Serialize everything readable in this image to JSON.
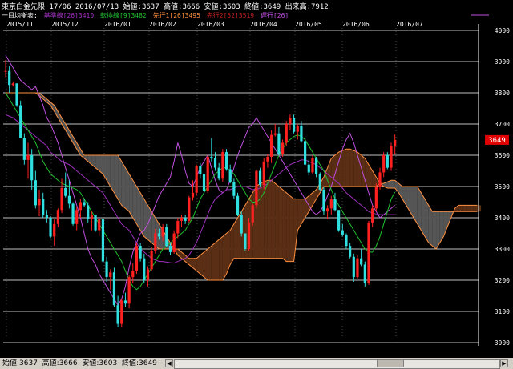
{
  "header": {
    "line1": "東京白金先限 17/06 2016/07/13 始値:3637 高値:3666 安値:3603 終値:3649 出来高:7912",
    "legend_prefix": "一目均衡表:",
    "legend": [
      {
        "label": "基準線[26]3410",
        "color": "#a030c0"
      },
      {
        "label": "転換線[9]3482",
        "color": "#20c030"
      },
      {
        "label": "先行1[26]3495",
        "color": "#ff9040"
      },
      {
        "label": "先行2[52]3519",
        "color": "#c02020"
      },
      {
        "label": "遅行[26]",
        "color": "#c050e0"
      }
    ]
  },
  "price_box": {
    "value": "3649",
    "color": "#e00000"
  },
  "status": {
    "text": "始値:3637  高値:3666  安値:3603  終値:3649"
  },
  "colors": {
    "background": "#000000",
    "grid": "#ffffff",
    "candle_up": "#ff2020",
    "candle_down": "#30e0e0",
    "kijun": "#a030c0",
    "tenkan": "#20c030",
    "senkou1": "#ff9040",
    "senkou2": "#c02020",
    "chikou": "#c050e0",
    "kumo_up": "#5a2e14",
    "kumo_down": "#555555"
  },
  "chart_data": {
    "type": "candlestick",
    "title": "東京白金先限",
    "months": [
      "2015/11",
      "2015/12",
      "2016/01",
      "2016/02",
      "2016/03",
      "2016/04",
      "2016/05",
      "2016/06",
      "2016/07"
    ],
    "ylim": [
      3000,
      4000
    ],
    "yticks": [
      "4000",
      "3900",
      "3800",
      "3700",
      "3600",
      "3500",
      "3400",
      "3300",
      "3200",
      "3100",
      "3000"
    ],
    "last_close": 3649,
    "candles": [
      [
        3870,
        3905,
        3850,
        3870
      ],
      [
        3870,
        3885,
        3800,
        3825
      ],
      [
        3825,
        3835,
        3820,
        3830
      ],
      [
        3830,
        3830,
        3755,
        3760
      ],
      [
        3760,
        3775,
        3655,
        3655
      ],
      [
        3655,
        3670,
        3570,
        3585
      ],
      [
        3585,
        3640,
        3525,
        3600
      ],
      [
        3600,
        3620,
        3490,
        3520
      ],
      [
        3520,
        3550,
        3430,
        3440
      ],
      [
        3440,
        3490,
        3405,
        3460
      ],
      [
        3460,
        3480,
        3400,
        3410
      ],
      [
        3410,
        3425,
        3385,
        3400
      ],
      [
        3400,
        3405,
        3335,
        3340
      ],
      [
        3340,
        3395,
        3310,
        3380
      ],
      [
        3380,
        3430,
        3370,
        3425
      ],
      [
        3425,
        3525,
        3415,
        3495
      ],
      [
        3495,
        3545,
        3465,
        3470
      ],
      [
        3470,
        3520,
        3430,
        3445
      ],
      [
        3445,
        3450,
        3375,
        3380
      ],
      [
        3380,
        3435,
        3360,
        3425
      ],
      [
        3425,
        3460,
        3400,
        3450
      ],
      [
        3450,
        3460,
        3435,
        3440
      ],
      [
        3440,
        3450,
        3385,
        3395
      ],
      [
        3395,
        3420,
        3360,
        3410
      ],
      [
        3410,
        3410,
        3355,
        3360
      ],
      [
        3360,
        3400,
        3340,
        3395
      ],
      [
        3395,
        3395,
        3255,
        3260
      ],
      [
        3260,
        3275,
        3195,
        3210
      ],
      [
        3210,
        3235,
        3170,
        3225
      ],
      [
        3225,
        3240,
        3115,
        3120
      ],
      [
        3120,
        3150,
        3050,
        3060
      ],
      [
        3060,
        3140,
        3050,
        3135
      ],
      [
        3135,
        3160,
        3115,
        3125
      ],
      [
        3125,
        3215,
        3110,
        3210
      ],
      [
        3210,
        3255,
        3190,
        3230
      ],
      [
        3230,
        3320,
        3220,
        3310
      ],
      [
        3310,
        3320,
        3260,
        3270
      ],
      [
        3270,
        3285,
        3190,
        3200
      ],
      [
        3200,
        3245,
        3180,
        3235
      ],
      [
        3235,
        3305,
        3230,
        3295
      ],
      [
        3295,
        3365,
        3285,
        3350
      ],
      [
        3350,
        3365,
        3330,
        3340
      ],
      [
        3340,
        3380,
        3325,
        3370
      ],
      [
        3370,
        3380,
        3305,
        3310
      ],
      [
        3310,
        3320,
        3280,
        3290
      ],
      [
        3290,
        3360,
        3285,
        3350
      ],
      [
        3350,
        3400,
        3335,
        3390
      ],
      [
        3390,
        3410,
        3370,
        3400
      ],
      [
        3400,
        3410,
        3380,
        3390
      ],
      [
        3390,
        3470,
        3385,
        3465
      ],
      [
        3465,
        3520,
        3455,
        3480
      ],
      [
        3480,
        3570,
        3470,
        3565
      ],
      [
        3565,
        3575,
        3525,
        3540
      ],
      [
        3540,
        3545,
        3480,
        3485
      ],
      [
        3485,
        3600,
        3480,
        3595
      ],
      [
        3595,
        3655,
        3580,
        3590
      ],
      [
        3590,
        3610,
        3550,
        3560
      ],
      [
        3560,
        3575,
        3520,
        3525
      ],
      [
        3525,
        3620,
        3515,
        3610
      ],
      [
        3610,
        3620,
        3550,
        3555
      ],
      [
        3555,
        3570,
        3510,
        3515
      ],
      [
        3515,
        3525,
        3460,
        3470
      ],
      [
        3470,
        3480,
        3405,
        3410
      ],
      [
        3410,
        3420,
        3340,
        3350
      ],
      [
        3350,
        3350,
        3295,
        3300
      ],
      [
        3300,
        3400,
        3295,
        3385
      ],
      [
        3385,
        3445,
        3375,
        3440
      ],
      [
        3440,
        3555,
        3430,
        3550
      ],
      [
        3550,
        3560,
        3500,
        3505
      ],
      [
        3505,
        3590,
        3490,
        3580
      ],
      [
        3580,
        3605,
        3560,
        3595
      ],
      [
        3595,
        3680,
        3575,
        3665
      ],
      [
        3665,
        3700,
        3660,
        3670
      ],
      [
        3670,
        3690,
        3600,
        3605
      ],
      [
        3605,
        3650,
        3595,
        3640
      ],
      [
        3640,
        3710,
        3630,
        3700
      ],
      [
        3700,
        3730,
        3680,
        3720
      ],
      [
        3720,
        3730,
        3670,
        3675
      ],
      [
        3675,
        3700,
        3650,
        3695
      ],
      [
        3695,
        3710,
        3640,
        3645
      ],
      [
        3645,
        3660,
        3565,
        3570
      ],
      [
        3570,
        3585,
        3535,
        3545
      ],
      [
        3545,
        3600,
        3540,
        3590
      ],
      [
        3590,
        3595,
        3530,
        3540
      ],
      [
        3540,
        3545,
        3485,
        3490
      ],
      [
        3490,
        3500,
        3410,
        3420
      ],
      [
        3420,
        3440,
        3395,
        3430
      ],
      [
        3430,
        3470,
        3410,
        3460
      ],
      [
        3460,
        3480,
        3420,
        3425
      ],
      [
        3425,
        3425,
        3355,
        3360
      ],
      [
        3360,
        3380,
        3340,
        3345
      ],
      [
        3345,
        3350,
        3300,
        3310
      ],
      [
        3310,
        3320,
        3270,
        3275
      ],
      [
        3275,
        3285,
        3195,
        3210
      ],
      [
        3210,
        3280,
        3205,
        3270
      ],
      [
        3270,
        3300,
        3245,
        3250
      ],
      [
        3250,
        3260,
        3180,
        3190
      ],
      [
        3190,
        3390,
        3185,
        3385
      ],
      [
        3385,
        3440,
        3370,
        3430
      ],
      [
        3430,
        3510,
        3420,
        3500
      ],
      [
        3500,
        3560,
        3490,
        3545
      ],
      [
        3545,
        3610,
        3530,
        3600
      ],
      [
        3600,
        3610,
        3555,
        3560
      ],
      [
        3560,
        3640,
        3550,
        3630
      ],
      [
        3630,
        3666,
        3603,
        3649
      ]
    ],
    "kijun": [
      3730,
      3725,
      3720,
      3710,
      3700,
      3690,
      3680,
      3670,
      3660,
      3650,
      3640,
      3630,
      3610,
      3600,
      3590,
      3580,
      3575,
      3570,
      3560,
      3550,
      3540,
      3530,
      3520,
      3510,
      3500,
      3490,
      3480,
      3460,
      3440,
      3420,
      3400,
      3380,
      3370,
      3360,
      3340,
      3320,
      3300,
      3290,
      3280,
      3270,
      3265,
      3260,
      3260,
      3258,
      3256,
      3255,
      3260,
      3265,
      3270,
      3280,
      3300,
      3320,
      3350,
      3380,
      3410,
      3440,
      3460,
      3470,
      3480,
      3490,
      3490,
      3495,
      3500,
      3500,
      3500,
      3495,
      3490,
      3490,
      3495,
      3500,
      3510,
      3520,
      3530,
      3540,
      3550,
      3560,
      3570,
      3575,
      3580,
      3585,
      3585,
      3580,
      3575,
      3570,
      3560,
      3550,
      3540,
      3530,
      3520,
      3510,
      3495,
      3480,
      3470,
      3460,
      3450,
      3440,
      3430,
      3420,
      3415,
      3412,
      3410,
      3410,
      3410,
      3410,
      3410
    ],
    "tenkan": [
      3800,
      3780,
      3760,
      3740,
      3720,
      3700,
      3680,
      3660,
      3640,
      3610,
      3580,
      3560,
      3540,
      3530,
      3520,
      3510,
      3505,
      3500,
      3495,
      3490,
      3480,
      3460,
      3440,
      3420,
      3400,
      3380,
      3360,
      3340,
      3320,
      3300,
      3280,
      3260,
      3230,
      3200,
      3180,
      3170,
      3180,
      3200,
      3220,
      3240,
      3260,
      3280,
      3300,
      3310,
      3320,
      3330,
      3340,
      3350,
      3360,
      3380,
      3400,
      3430,
      3460,
      3480,
      3500,
      3520,
      3540,
      3550,
      3560,
      3560,
      3550,
      3540,
      3520,
      3500,
      3480,
      3460,
      3450,
      3450,
      3460,
      3480,
      3510,
      3540,
      3570,
      3600,
      3620,
      3640,
      3650,
      3660,
      3665,
      3660,
      3650,
      3630,
      3610,
      3590,
      3570,
      3550,
      3520,
      3490,
      3460,
      3440,
      3420,
      3400,
      3380,
      3360,
      3340,
      3320,
      3300,
      3290,
      3290,
      3310,
      3340,
      3380,
      3420,
      3460,
      3482
    ],
    "senkou1": [
      3800,
      3800,
      3800,
      3800,
      3800,
      3800,
      3800,
      3800,
      3800,
      3790,
      3780,
      3770,
      3760,
      3740,
      3720,
      3700,
      3680,
      3660,
      3640,
      3620,
      3600,
      3590,
      3580,
      3570,
      3560,
      3550,
      3540,
      3520,
      3500,
      3480,
      3460,
      3440,
      3430,
      3420,
      3400,
      3380,
      3360,
      3340,
      3330,
      3320,
      3310,
      3300,
      3300,
      3300,
      3300,
      3300,
      3300,
      3290,
      3280,
      3270,
      3270,
      3270,
      3280,
      3290,
      3300,
      3310,
      3320,
      3330,
      3340,
      3350,
      3360,
      3380,
      3400,
      3420,
      3440,
      3460,
      3480,
      3500,
      3510,
      3515,
      3520,
      3520,
      3510,
      3500,
      3490,
      3480,
      3470,
      3460,
      3460,
      3460,
      3460,
      3470,
      3480,
      3490,
      3510,
      3530,
      3560,
      3590,
      3600,
      3610,
      3615,
      3620,
      3620,
      3615,
      3610,
      3600,
      3590,
      3570,
      3550,
      3530,
      3510,
      3500,
      3495,
      3495,
      3495,
      3480,
      3460,
      3440,
      3420,
      3400,
      3380,
      3360,
      3340,
      3320,
      3310,
      3300,
      3320,
      3340,
      3370,
      3400,
      3430,
      3440,
      3440,
      3440,
      3440,
      3440,
      3440,
      3440,
      3440,
      3440
    ],
    "senkou2": [
      3800,
      3800,
      3800,
      3800,
      3800,
      3800,
      3800,
      3800,
      3800,
      3800,
      3790,
      3780,
      3770,
      3760,
      3740,
      3720,
      3700,
      3680,
      3660,
      3640,
      3620,
      3600,
      3600,
      3600,
      3600,
      3600,
      3600,
      3600,
      3600,
      3600,
      3600,
      3580,
      3560,
      3540,
      3520,
      3500,
      3480,
      3460,
      3440,
      3420,
      3400,
      3380,
      3360,
      3340,
      3320,
      3300,
      3280,
      3270,
      3260,
      3250,
      3240,
      3230,
      3220,
      3210,
      3200,
      3200,
      3200,
      3200,
      3200,
      3220,
      3250,
      3270,
      3270,
      3270,
      3270,
      3270,
      3270,
      3270,
      3270,
      3270,
      3270,
      3270,
      3270,
      3270,
      3270,
      3260,
      3260,
      3260,
      3360,
      3380,
      3400,
      3420,
      3440,
      3460,
      3480,
      3500,
      3500,
      3500,
      3500,
      3500,
      3500,
      3500,
      3500,
      3500,
      3500,
      3500,
      3500,
      3500,
      3500,
      3500,
      3510,
      3510,
      3515,
      3520,
      3520,
      3510,
      3500,
      3500,
      3500,
      3500,
      3500,
      3480,
      3460,
      3440,
      3420,
      3420,
      3420,
      3420,
      3420,
      3420,
      3420,
      3420,
      3420,
      3420,
      3420,
      3420,
      3420,
      3420,
      3420,
      3420
    ],
    "chikou": [
      3920,
      3900,
      3880,
      3860,
      3840,
      3830,
      3820,
      3810,
      3820,
      3790,
      3760,
      3720,
      3700,
      3670,
      3640,
      3600,
      3560,
      3520,
      3480,
      3440,
      3400,
      3350,
      3300,
      3270,
      3250,
      3220,
      3200,
      3180,
      3160,
      3140,
      3120,
      3140,
      3180,
      3240,
      3290,
      3320,
      3350,
      3360,
      3380,
      3410,
      3440,
      3470,
      3490,
      3510,
      3530,
      3580,
      3640,
      3600,
      3550,
      3510,
      3500,
      3530,
      3560,
      3580,
      3600,
      3560,
      3520,
      3490,
      3480,
      3490,
      3520,
      3560,
      3600,
      3630,
      3660,
      3690,
      3700,
      3720,
      3700,
      3680,
      3660,
      3640,
      3620,
      3600,
      3580,
      3560,
      3540,
      3520,
      3500,
      3480,
      3460,
      3440,
      3420,
      3410,
      3420,
      3440,
      3470,
      3500,
      3540,
      3580,
      3620,
      3650,
      3670,
      3640,
      3600,
      3560,
      3520,
      3480,
      3440,
      3420,
      3400,
      3410,
      3420,
      3430,
      3440
    ]
  }
}
